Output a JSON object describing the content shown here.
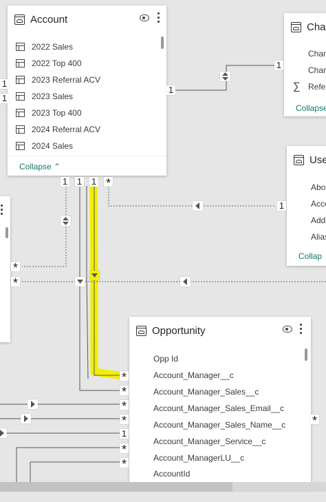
{
  "account": {
    "title": "Account",
    "rows": [
      "2022 Sales",
      "2022 Top 400",
      "2023 Referral ACV",
      "2023 Sales",
      "2023 Top 400",
      "2024 Referral ACV",
      "2024 Sales"
    ],
    "collapse": "Collapse"
  },
  "channel": {
    "title": "Cha",
    "rows": [
      "Char",
      "Char",
      "Refer"
    ],
    "collapse": "Collapse"
  },
  "user": {
    "title": "Use",
    "rows": [
      "Abo",
      "Acce",
      "Add",
      "Alias"
    ],
    "collapse": "Collap"
  },
  "opportunity": {
    "title": "Opportunity",
    "rows": [
      "Opp Id",
      "Account_Manager__c",
      "Account_Manager_Sales__c",
      "Account_Manager_Sales_Email__c",
      "Account_Manager_Sales_Name__c",
      "Account_Manager_Service__c",
      "Account_ManagerLU__c",
      "AccountId"
    ]
  },
  "cardinality": {
    "one": "1",
    "many": "*"
  },
  "colors": {
    "highlight": "#f2ee00",
    "accent": "#117865",
    "canvas": "#e6e6e6"
  }
}
